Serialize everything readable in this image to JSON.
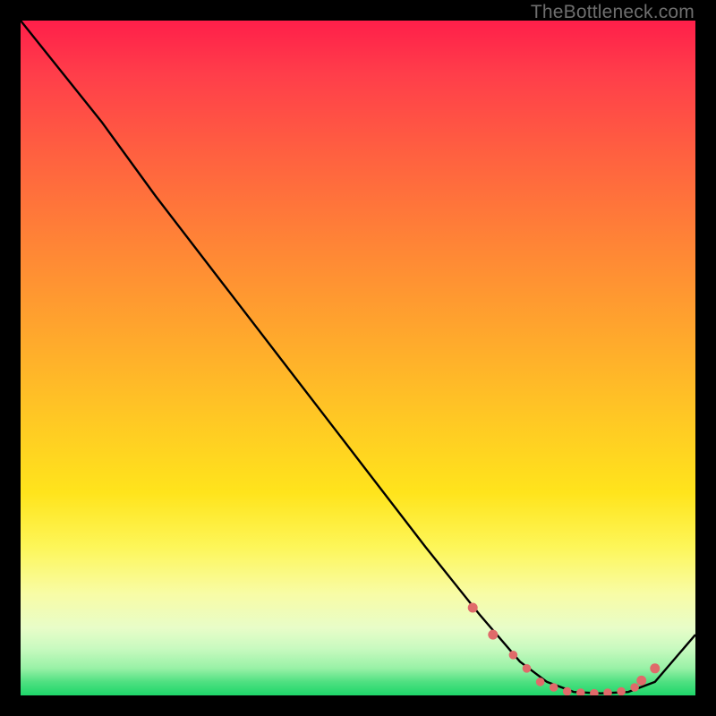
{
  "watermark": "TheBottleneck.com",
  "colors": {
    "gradient_top": "#ff1f4a",
    "gradient_mid": "#ffe41c",
    "gradient_bottom": "#1ed66a",
    "line": "#000000",
    "marker": "#e06a6a",
    "background": "#000000"
  },
  "chart_data": {
    "type": "line",
    "title": "",
    "xlabel": "",
    "ylabel": "",
    "xlim": [
      0,
      100
    ],
    "ylim": [
      0,
      100
    ],
    "series": [
      {
        "name": "curve",
        "x": [
          0,
          4,
          8,
          12,
          20,
          30,
          40,
          50,
          60,
          68,
          74,
          78,
          82,
          86,
          90,
          94,
          100
        ],
        "y": [
          100,
          95,
          90,
          85,
          74,
          61,
          48,
          35,
          22,
          12,
          5,
          2,
          0.5,
          0.3,
          0.5,
          2,
          9
        ]
      }
    ],
    "markers": {
      "name": "highlight-points",
      "x": [
        67,
        70,
        73,
        75,
        77,
        79,
        81,
        83,
        85,
        87,
        89,
        91,
        92,
        94
      ],
      "y": [
        13,
        9,
        6,
        4,
        2,
        1.2,
        0.6,
        0.4,
        0.3,
        0.4,
        0.6,
        1.2,
        2.2,
        4
      ]
    }
  }
}
